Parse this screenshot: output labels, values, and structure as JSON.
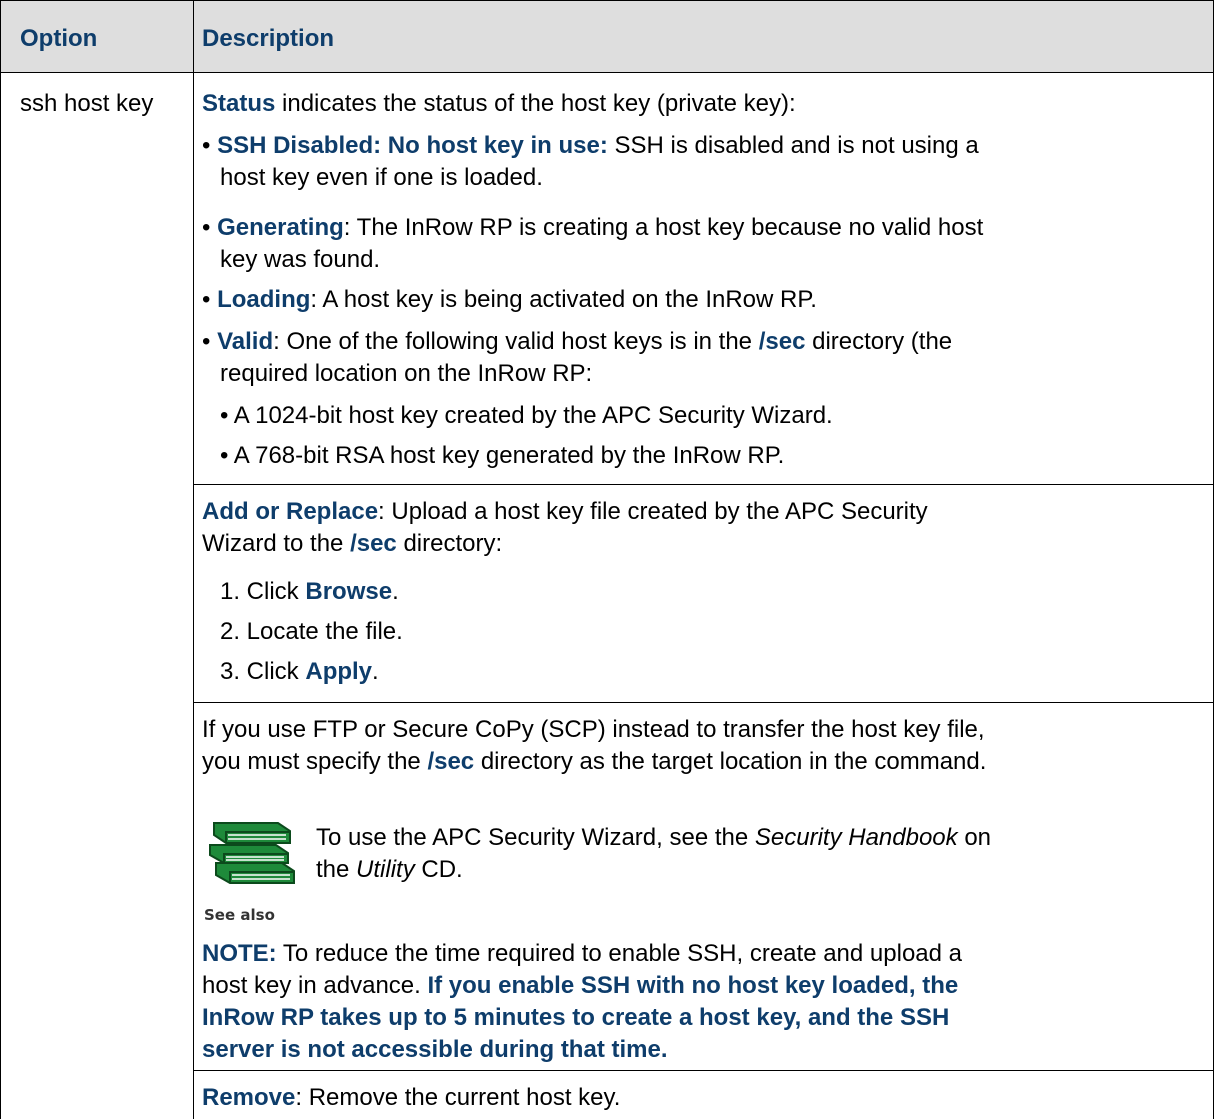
{
  "header": {
    "col1": "Option",
    "col2": "Description"
  },
  "option": {
    "name": "ssh host key"
  },
  "status": {
    "label": "Status",
    "intro": " indicates the status of the host key (private key):",
    "items": [
      {
        "bullet": "• ",
        "label": "SSH Disabled: No host key in use:",
        "text_line1": " SSH is disabled and is not using a",
        "text_line2": "host key even if one is loaded."
      },
      {
        "bullet": "• ",
        "label": "Generating",
        "text_line1": ": The InRow RP is creating a host key because no valid host",
        "text_line2": "key was found."
      },
      {
        "bullet": "• ",
        "label": "Loading",
        "text_line1": ": A host key is being activated on the InRow RP."
      },
      {
        "bullet": "• ",
        "label": "Valid",
        "text_line1a": ": One of the following valid host keys is in the ",
        "path": "/sec",
        "text_line1b": " directory (the",
        "text_line2": "required location on the InRow RP:"
      }
    ],
    "subitems": [
      "• A 1024-bit host key created by the APC Security Wizard.",
      "• A 768-bit RSA host key generated by the InRow RP."
    ]
  },
  "add_replace": {
    "label": "Add or Replace",
    "text_line1": ": Upload a host key file created by the APC Security",
    "text_line2a": "Wizard to the ",
    "path": "/sec",
    "text_line2b": " directory:",
    "steps": [
      {
        "num": "1. Click ",
        "bold": "Browse",
        "end": "."
      },
      {
        "num": "2. Locate the file.",
        "bold": "",
        "end": ""
      },
      {
        "num": "3. Click ",
        "bold": "Apply",
        "end": "."
      }
    ]
  },
  "ftp": {
    "line1": "If you use FTP or Secure CoPy (SCP) instead to transfer the host key file,",
    "line2a": "you must specify the ",
    "path": "/sec",
    "line2b": " directory as the target location in the command."
  },
  "see_also": {
    "icon_caption": "See also",
    "line1a": "To use the APC Security Wizard, see the ",
    "line1_italic": "Security Handbook",
    "line1b": " on",
    "line2a": "the ",
    "line2_italic": "Utility",
    "line2b": " CD."
  },
  "note": {
    "label": "NOTE:",
    "line1": " To reduce the time required to enable SSH, create and upload a",
    "line2a": "host key in advance. ",
    "line2_bold": "If you enable SSH with no host key loaded, the",
    "line3": "InRow RP takes up to 5 minutes to create a host key, and the SSH",
    "line4": "server is not accessible during that time."
  },
  "remove": {
    "label": "Remove",
    "text": ": Remove the current host key."
  },
  "colors": {
    "accent": "#0e3d6b",
    "header_bg": "#dedede",
    "book_green": "#1e8a3a"
  }
}
